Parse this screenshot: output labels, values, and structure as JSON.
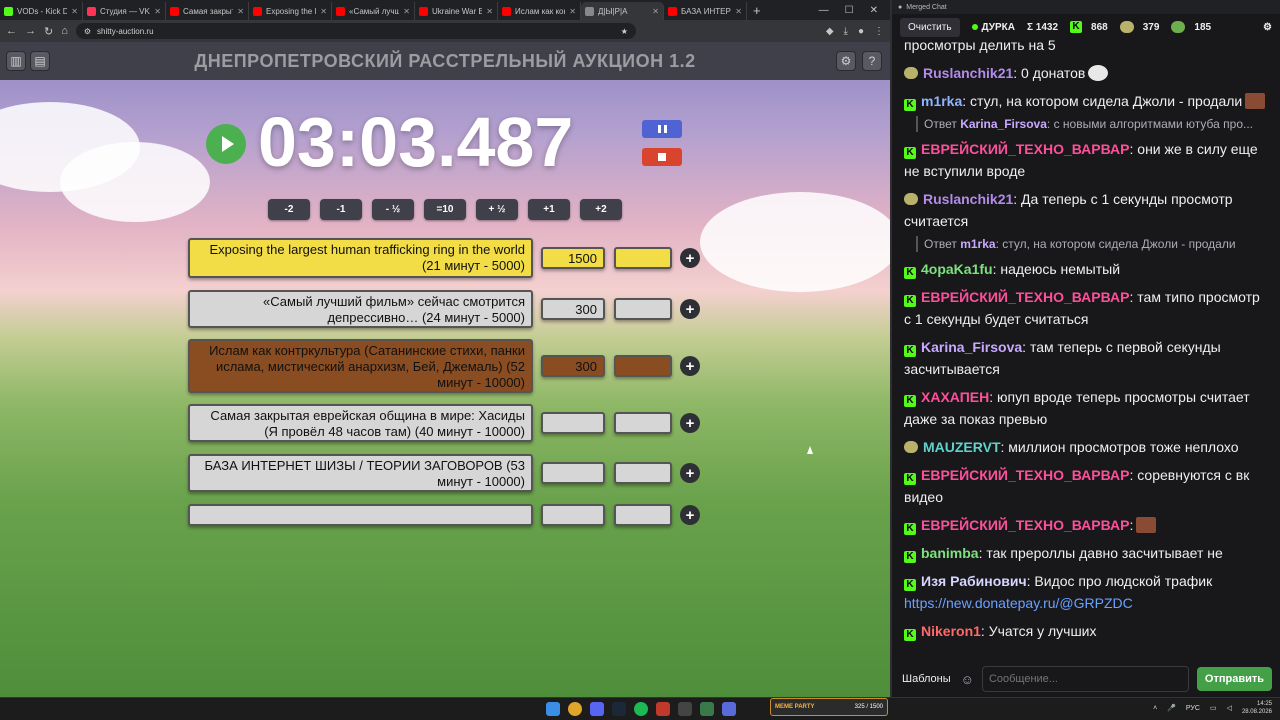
{
  "browser": {
    "tabs": [
      {
        "title": "VODs - Kick Dashb",
        "color": "#53fc18"
      },
      {
        "title": "Студия — VK Вид",
        "color": "#ff3355"
      },
      {
        "title": "Самая закрытая",
        "color": "#ff0000"
      },
      {
        "title": "Exposing the large",
        "color": "#ff0000"
      },
      {
        "title": "«Самый лучший»",
        "color": "#ff0000"
      },
      {
        "title": "Ukraine War Expe",
        "color": "#ff0000"
      },
      {
        "title": "Ислам как контр",
        "color": "#ff0000"
      },
      {
        "title": "Д|Ы|Р|А",
        "color": "#888888"
      },
      {
        "title": "БАЗА ИНТЕРНЕТ",
        "color": "#ff0000"
      }
    ],
    "url": "shitty-auction.ru"
  },
  "app": {
    "title": "ДНЕПРОПЕТРОВСКИЙ РАССТРЕЛЬНЫЙ АУКЦИОН 1.2",
    "timer": "03:03.487",
    "time_buttons": [
      "-2",
      "-1",
      "- ½",
      "=10",
      "+ ½",
      "+1",
      "+2"
    ]
  },
  "lots": [
    {
      "text": "Exposing the largest human trafficking ring in the world (21 минут - 5000)",
      "amount": "1500",
      "color": "yellow"
    },
    {
      "text": "«Самый лучший фильм» сейчас смотрится депрессивно… (24 минут - 5000)",
      "amount": "300",
      "color": "gray"
    },
    {
      "text": "Ислам как контркультура (Сатанинские стихи, панки ислама, мистический анархизм,  Бей, Джемаль) (52 минут - 10000)",
      "amount": "300",
      "color": "brown"
    },
    {
      "text": "Самая закрытая еврейская община в мире: Хасиды (Я провёл 48 часов там) (40 минут - 10000)",
      "amount": "",
      "color": "gray"
    },
    {
      "text": "БАЗА ИНТЕРНЕТ ШИЗЫ / ТЕОРИИ ЗАГОВОРОВ (53 минут - 10000)",
      "amount": "",
      "color": "gray"
    },
    {
      "text": "",
      "amount": "",
      "color": "gray"
    }
  ],
  "chat": {
    "window_title": "Merged Chat",
    "clear_label": "Очистить",
    "channel": "ДУРКА",
    "total": "Σ 1432",
    "kick_count": "868",
    "twitch_count": "379",
    "other_count": "185",
    "partial_top": "просмотры делить на 5",
    "messages": [
      {
        "platform": "twitch",
        "nick": "Ruslanchik21",
        "color": "#b28ce8",
        "text": ": 0 донатов",
        "emote": "g"
      },
      {
        "platform": "kick",
        "nick": "m1rka",
        "color": "#8fb4ff",
        "text": ": стул, на котором сидела Джоли - продали",
        "emote": "b"
      },
      {
        "reply_prefix": "Ответ",
        "reply_to": "Karina_Firsova",
        "reply_text": ": с новыми алгоритмами ютуба про..."
      },
      {
        "platform": "kick",
        "nick": "ЕВРЕЙСКИЙ_ТЕХНО_ВАРВАР",
        "color": "#ff4f9a",
        "text": ": они же в силу еще не вступили вроде"
      },
      {
        "platform": "twitch",
        "nick": "Ruslanchik21",
        "color": "#b28ce8",
        "text": ": Да теперь с 1 секунды просмотр считается"
      },
      {
        "reply_prefix": "Ответ",
        "reply_to": "m1rka",
        "reply_text": ": стул, на котором сидела Джоли - продали"
      },
      {
        "platform": "kick",
        "nick": "4opaKa1fu",
        "color": "#7ee07e",
        "text": ": надеюсь немытый"
      },
      {
        "platform": "kick",
        "nick": "ЕВРЕЙСКИЙ_ТЕХНО_ВАРВАР",
        "color": "#ff4f9a",
        "text": ": там типо просмотр с 1 секунды будет считаться"
      },
      {
        "platform": "kick",
        "nick": "Karina_Firsova",
        "color": "#c9a9ff",
        "text": ": там теперь с первой секунды засчитывается"
      },
      {
        "platform": "kick",
        "nick": "ХАХАПЕН",
        "color": "#ff4f9a",
        "text": ": юпуп вроде теперь просмотры считает даже за показ превью"
      },
      {
        "platform": "twitch",
        "nick": "MAUZERVT",
        "color": "#5fd3c9",
        "text": ": миллион просмотров тоже неплохо"
      },
      {
        "platform": "kick",
        "nick": "ЕВРЕЙСКИЙ_ТЕХНО_ВАРВАР",
        "color": "#ff4f9a",
        "text": ": соревнуются с вк видео"
      },
      {
        "platform": "kick",
        "nick": "ЕВРЕЙСКИЙ_ТЕХНО_ВАРВАР",
        "color": "#ff4f9a",
        "text": ":",
        "emote": "b"
      },
      {
        "platform": "kick",
        "nick": "banimba",
        "color": "#7ee07e",
        "text": ": так прероллы давно засчитывает не"
      },
      {
        "platform": "kick",
        "nick": "Изя Рабинович",
        "color": "#d6d6ff",
        "text": ": Видос про людской трафик",
        "link": "https://new.donatepay.ru/@GRPZDC"
      },
      {
        "platform": "kick",
        "nick": "Nikeron1",
        "color": "#ff6a6a",
        "text": ": Учатся у лучших"
      }
    ],
    "templates_label": "Шаблоны",
    "input_placeholder": "Сообщение...",
    "send_label": "Отправить"
  },
  "taskbar": {
    "meme_label": "MEME PARTY",
    "meme_progress": "325 / 1500",
    "lang": "РУС",
    "time": "14:25",
    "date": "28.08.2026"
  }
}
